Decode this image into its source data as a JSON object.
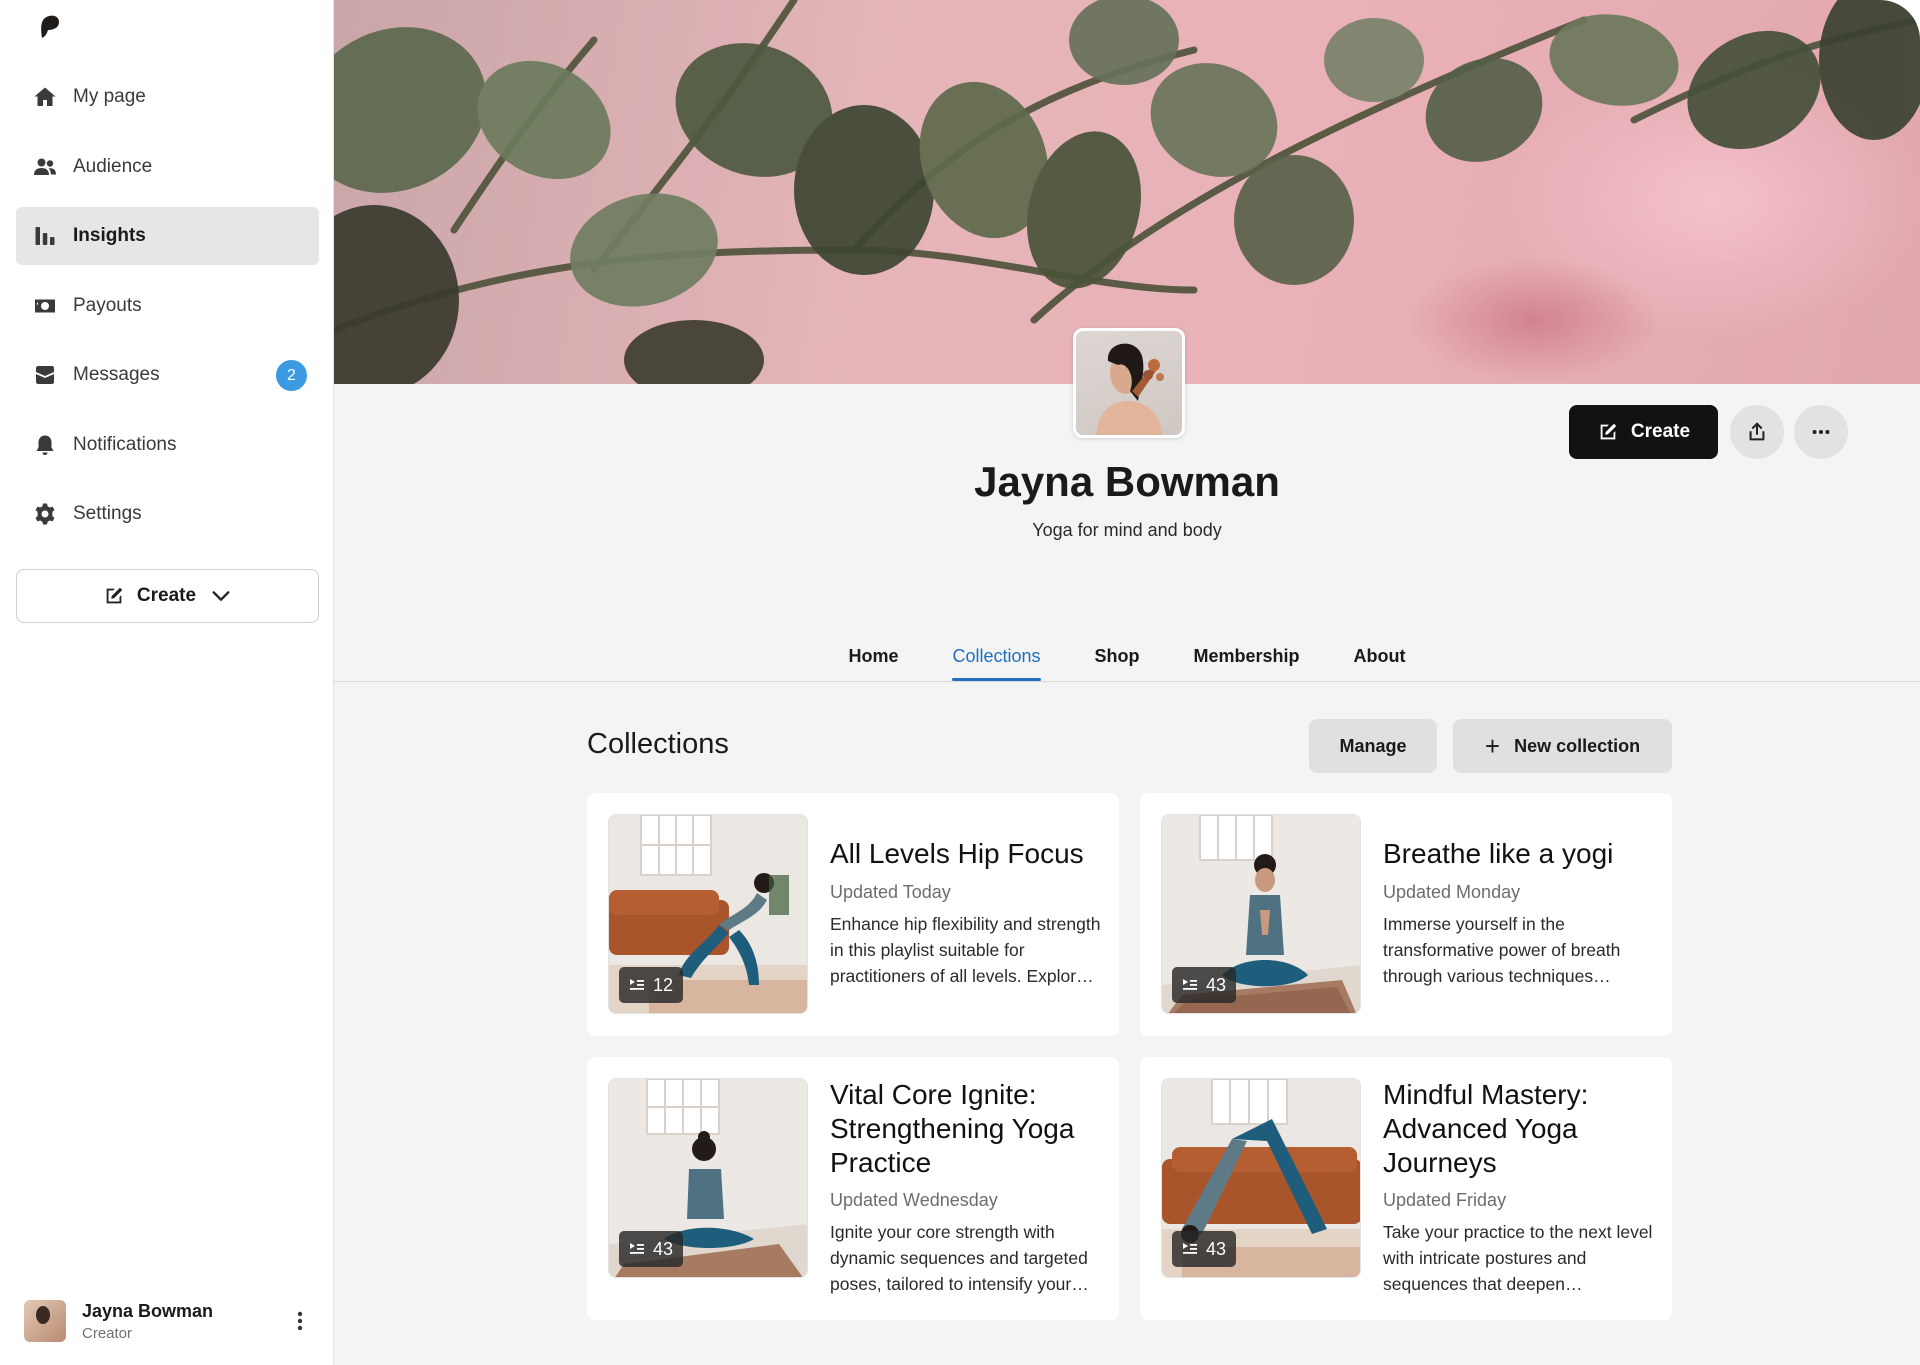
{
  "sidebar": {
    "items": [
      {
        "label": "My page",
        "icon": "home-icon"
      },
      {
        "label": "Audience",
        "icon": "people-icon"
      },
      {
        "label": "Insights",
        "icon": "bar-chart-icon",
        "active": true
      },
      {
        "label": "Payouts",
        "icon": "money-icon"
      },
      {
        "label": "Messages",
        "icon": "inbox-icon",
        "badge": "2"
      },
      {
        "label": "Notifications",
        "icon": "bell-icon"
      },
      {
        "label": "Settings",
        "icon": "gear-icon"
      }
    ],
    "create_label": "Create",
    "user": {
      "name": "Jayna Bowman",
      "role": "Creator"
    }
  },
  "profile": {
    "name": "Jayna Bowman",
    "tagline": "Yoga for mind and body",
    "create_label": "Create"
  },
  "tabs": [
    {
      "label": "Home"
    },
    {
      "label": "Collections",
      "active": true
    },
    {
      "label": "Shop"
    },
    {
      "label": "Membership"
    },
    {
      "label": "About"
    }
  ],
  "collections": {
    "title": "Collections",
    "manage_label": "Manage",
    "new_label": "New collection",
    "items": [
      {
        "title": "All Levels Hip Focus",
        "updated": "Updated Today",
        "description": "Enhance hip flexibility and strength in this playlist suitable for practitioners of all levels. Explore a range of hip-opening poses.",
        "count": "12"
      },
      {
        "title": "Breathe like a yogi",
        "updated": "Updated Monday",
        "description": "Immerse yourself in the transformative power of breath through various techniques designed to calm the mind.",
        "count": "43"
      },
      {
        "title": "Vital Core Ignite: Strengthening Yoga Practice",
        "updated": "Updated Wednesday",
        "description": "Ignite your core strength with dynamic sequences and targeted poses, tailored to intensify your practice.",
        "count": "43"
      },
      {
        "title": "Mindful Mastery: Advanced Yoga Journeys",
        "updated": "Updated Friday",
        "description": "Take your practice to the next level with intricate postures and sequences that deepen mindfulness.",
        "count": "43"
      }
    ]
  },
  "colors": {
    "accent": "#1f6fbf",
    "badge": "#3b9ae1",
    "primary_button": "#121212"
  }
}
